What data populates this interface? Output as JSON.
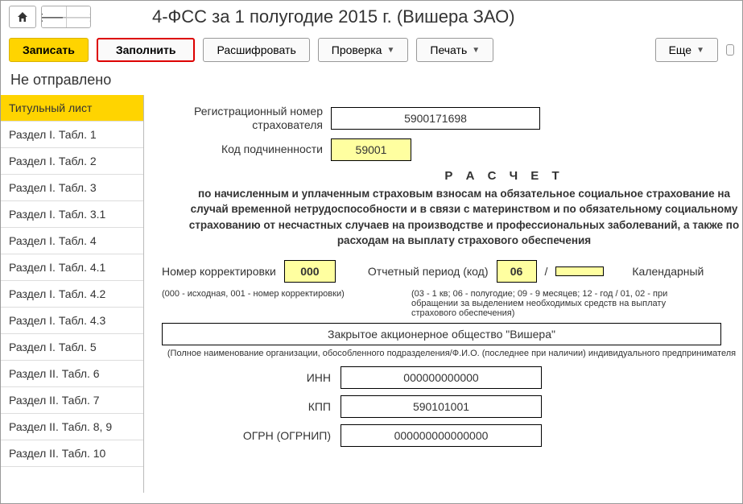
{
  "header": {
    "title": "4-ФСС за 1 полугодие 2015 г. (Вишера ЗАО)"
  },
  "toolbar": {
    "save": "Записать",
    "fill": "Заполнить",
    "decode": "Расшифровать",
    "check": "Проверка",
    "print": "Печать",
    "more": "Еще"
  },
  "status": "Не отправлено",
  "sidebar": {
    "items": [
      "Титульный лист",
      "Раздел I. Табл. 1",
      "Раздел I. Табл. 2",
      "Раздел I. Табл. 3",
      "Раздел I. Табл. 3.1",
      "Раздел I. Табл. 4",
      "Раздел I. Табл. 4.1",
      "Раздел I. Табл. 4.2",
      "Раздел I. Табл. 4.3",
      "Раздел I. Табл. 5",
      "Раздел II. Табл. 6",
      "Раздел II. Табл. 7",
      "Раздел II. Табл. 8, 9",
      "Раздел II. Табл. 10"
    ]
  },
  "form": {
    "reg_label": "Регистрационный номер\nстрахователя",
    "reg_value": "5900171698",
    "sub_label": "Код подчиненности",
    "sub_value": "59001",
    "calc_title": "Р А С Ч Е Т",
    "calc_desc": "по начисленным и уплаченным страховым взносам на обязательное социальное страхование на случай временной нетрудоспособности и в связи с материнством и по обязательному социальному страхованию от несчастных случаев на производстве и профессиональных заболеваний, а также по расходам на выплату страхового обеспечения",
    "corr_label": "Номер корректировки",
    "corr_value": "000",
    "period_label": "Отчетный период (код)",
    "period_value": "06",
    "slash": "/",
    "cal_label": "Календарный",
    "corr_note": "(000 - исходная, 001 - номер корректировки)",
    "period_note": "(03 - 1 кв; 06 - полугодие; 09 - 9 месяцев; 12 - год / 01, 02 - при обращении за выделением необходимых средств на  выплату страхового обеспечения)",
    "org_name": "Закрытое акционерное общество \"Вишера\"",
    "org_note": "(Полное наименование организации, обособленного подразделения/Ф.И.О. (последнее при наличии) индивидуального предпринимателя",
    "inn_label": "ИНН",
    "inn_value": "000000000000",
    "kpp_label": "КПП",
    "kpp_value": "590101001",
    "ogrn_label": "ОГРН (ОГРНИП)",
    "ogrn_value": "000000000000000"
  }
}
